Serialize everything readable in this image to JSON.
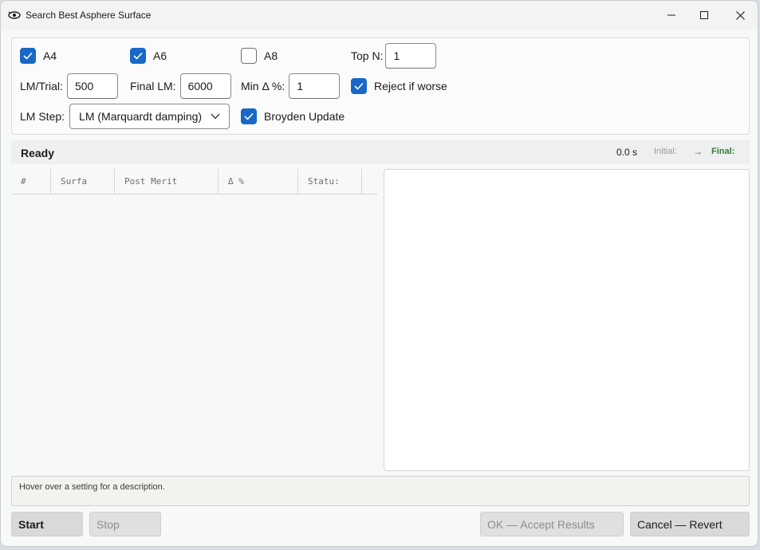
{
  "window": {
    "title": "Search Best Asphere Surface"
  },
  "settings": {
    "a4": {
      "label": "A4",
      "checked": true
    },
    "a6": {
      "label": "A6",
      "checked": true
    },
    "a8": {
      "label": "A8",
      "checked": false
    },
    "top_n": {
      "label": "Top N:",
      "value": "1"
    },
    "lm_trial": {
      "label": "LM/Trial:",
      "value": "500"
    },
    "final_lm": {
      "label": "Final LM:",
      "value": "6000"
    },
    "min_delta": {
      "label": "Min Δ %:",
      "value": "1"
    },
    "reject_if_worse": {
      "label": "Reject if worse",
      "checked": true
    },
    "lm_step": {
      "label": "LM Step:",
      "selected": "LM (Marquardt damping)"
    },
    "broyden": {
      "label": "Broyden Update",
      "checked": true
    }
  },
  "status": {
    "state": "Ready",
    "elapsed": "0.0 s",
    "initial_label": "Initial:",
    "arrow": "→",
    "final_label": "Final:"
  },
  "table": {
    "columns": [
      "#",
      "Surfa",
      "Post Merit",
      "Δ %",
      "Statu:"
    ],
    "rows": []
  },
  "description": "Hover over a setting for a description.",
  "buttons": {
    "start": "Start",
    "stop": "Stop",
    "ok": "OK — Accept Results",
    "cancel": "Cancel — Revert"
  },
  "colors": {
    "accent": "#1868c8",
    "final_green": "#2e7d32"
  }
}
